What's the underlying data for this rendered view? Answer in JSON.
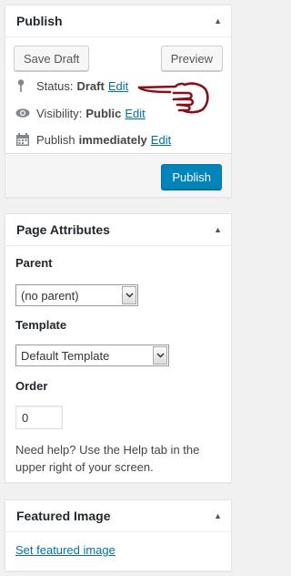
{
  "publish": {
    "title": "Publish",
    "save_draft": "Save Draft",
    "preview": "Preview",
    "status_label": "Status:",
    "status_value": "Draft",
    "status_edit": "Edit",
    "visibility_label": "Visibility:",
    "visibility_value": "Public",
    "visibility_edit": "Edit",
    "schedule_label": "Publish",
    "schedule_value": "immediately",
    "schedule_edit": "Edit",
    "publish_button": "Publish"
  },
  "page_attributes": {
    "title": "Page Attributes",
    "parent_label": "Parent",
    "parent_value": "(no parent)",
    "template_label": "Template",
    "template_value": "Default Template",
    "order_label": "Order",
    "order_value": "0",
    "help_text": "Need help? Use the Help tab in the upper right of your screen."
  },
  "featured_image": {
    "title": "Featured Image",
    "link": "Set featured image"
  },
  "icons": {
    "toggle": "triangle-up-icon",
    "status": "pin-icon",
    "visibility": "eye-icon",
    "schedule": "calendar-icon",
    "annotation": "pointing-hand-icon"
  },
  "colors": {
    "primary": "#0085ba",
    "link": "#0073aa",
    "annotation": "#8b0f1a"
  }
}
